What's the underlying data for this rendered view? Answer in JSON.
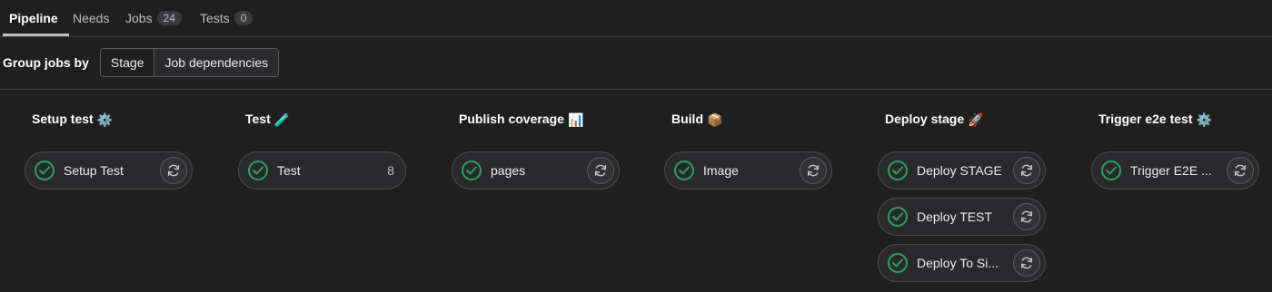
{
  "tabs": [
    {
      "label": "Pipeline",
      "active": true
    },
    {
      "label": "Needs"
    },
    {
      "label": "Jobs",
      "count": "24"
    },
    {
      "label": "Tests",
      "count": "0"
    }
  ],
  "group_by": {
    "label": "Group jobs by",
    "options": [
      "Stage",
      "Job dependencies"
    ],
    "selected": "Stage"
  },
  "stages": [
    {
      "title": "Setup test",
      "emoji": "⚙️",
      "jobs": [
        {
          "name": "Setup Test",
          "status": "success"
        }
      ]
    },
    {
      "title": "Test",
      "emoji": "🧪",
      "jobs": [
        {
          "name": "Test",
          "count": "8",
          "status": "success"
        }
      ]
    },
    {
      "title": "Publish coverage",
      "emoji": "📊",
      "jobs": [
        {
          "name": "pages",
          "status": "success"
        }
      ]
    },
    {
      "title": "Build",
      "emoji": "📦",
      "jobs": [
        {
          "name": "Image",
          "status": "success"
        }
      ]
    },
    {
      "title": "Deploy stage",
      "emoji": "🚀",
      "jobs": [
        {
          "name": "Deploy STAGE",
          "status": "success"
        },
        {
          "name": "Deploy TEST",
          "status": "success"
        },
        {
          "name": "Deploy To Si...",
          "status": "success"
        }
      ]
    },
    {
      "title": "Trigger e2e test",
      "emoji": "⚙️",
      "jobs": [
        {
          "name": "Trigger E2E ...",
          "status": "success"
        }
      ]
    }
  ],
  "colors": {
    "success": "#2da160",
    "background": "#1f1f1f"
  },
  "icons": {
    "status": "check-circle-icon",
    "retry": "retry-icon"
  }
}
